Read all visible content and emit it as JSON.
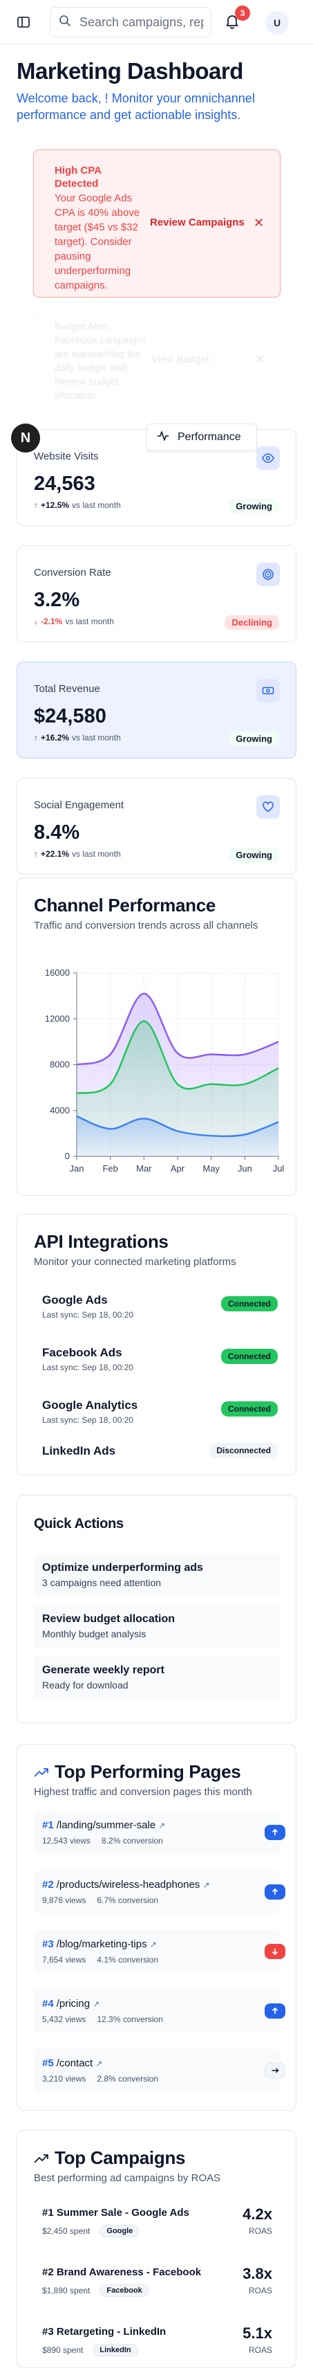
{
  "topbar": {
    "search_placeholder": "Search campaigns, reports...",
    "notification_count": "3",
    "avatar_initial": "U"
  },
  "header": {
    "title": "Marketing Dashboard",
    "subtitle": "Welcome back, ! Monitor your omnichannel performance and get actionable insights."
  },
  "alerts": [
    {
      "title": "High CPA Detected",
      "text": "Your Google Ads CPA is 40% above target ($45 vs $32 target). Consider pausing underperforming campaigns.",
      "action": "Review Campaigns",
      "close": "✕"
    },
    {
      "title": "Budget Alert",
      "text": "Facebook campaigns are approaching the daily budget limit. Review budget allocation.",
      "action": "View Budget",
      "close": "✕"
    }
  ],
  "floating": {
    "logo_letter": "N",
    "tooltip_label": "Performance"
  },
  "kpis": [
    {
      "label": "Website Visits",
      "value": "24,563",
      "change": "+12.5%",
      "period": "vs last month",
      "status": "Growing",
      "direction": "up",
      "icon": "eye-icon"
    },
    {
      "label": "Conversion Rate",
      "value": "3.2%",
      "change": "-2.1%",
      "period": "vs last month",
      "status": "Declining",
      "direction": "down",
      "icon": "target-icon"
    },
    {
      "label": "Total Revenue",
      "value": "$24,580",
      "change": "+16.2%",
      "period": "vs last month",
      "status": "Growing",
      "direction": "up",
      "icon": "money-icon"
    },
    {
      "label": "Social Engagement",
      "value": "8.4%",
      "change": "+22.1%",
      "period": "vs last month",
      "status": "Growing",
      "direction": "up",
      "icon": "heart-icon"
    }
  ],
  "channel_performance": {
    "title": "Channel Performance",
    "subtitle": "Traffic and conversion trends across all channels"
  },
  "chart_data": {
    "type": "area",
    "categories": [
      "Jan",
      "Feb",
      "Mar",
      "Apr",
      "May",
      "Jun",
      "Jul"
    ],
    "ylim": [
      0,
      16000
    ],
    "yticks": [
      0,
      4000,
      8000,
      12000,
      16000
    ],
    "grid": true,
    "series": [
      {
        "color": "#8b5cf6",
        "values": [
          8000,
          8900,
          14200,
          9000,
          8900,
          8900,
          10000
        ]
      },
      {
        "color": "#22c55e",
        "values": [
          5500,
          6300,
          11800,
          6300,
          6300,
          6300,
          7700
        ]
      },
      {
        "color": "#3b82f6",
        "values": [
          3500,
          2400,
          3300,
          2200,
          1800,
          1900,
          3000
        ]
      }
    ],
    "title": "",
    "xlabel": "",
    "ylabel": ""
  },
  "api_integrations": {
    "title": "API Integrations",
    "subtitle": "Monitor your connected marketing platforms",
    "items": [
      {
        "name": "Google Ads",
        "sync": "Last sync: Sep 18, 00:20",
        "status": "Connected"
      },
      {
        "name": "Facebook Ads",
        "sync": "Last sync: Sep 18, 00:20",
        "status": "Connected"
      },
      {
        "name": "Google Analytics",
        "sync": "Last sync: Sep 18, 00:20",
        "status": "Connected"
      },
      {
        "name": "LinkedIn Ads",
        "sync": "",
        "status": "Disconnected"
      }
    ]
  },
  "quick_actions": {
    "title": "Quick Actions",
    "items": [
      {
        "title": "Optimize underperforming ads",
        "subtitle": "3 campaigns need attention"
      },
      {
        "title": "Review budget allocation",
        "subtitle": "Monthly budget analysis"
      },
      {
        "title": "Generate weekly report",
        "subtitle": "Ready for download"
      }
    ]
  },
  "top_pages": {
    "title": "Top Performing Pages",
    "subtitle": "Highest traffic and conversion pages this month",
    "items": [
      {
        "rank": "#1",
        "path": "/landing/summer-sale",
        "views": "12,543 views",
        "conversion": "8.2% conversion",
        "trend": "up"
      },
      {
        "rank": "#2",
        "path": "/products/wireless-headphones",
        "views": "9,876 views",
        "conversion": "6.7% conversion",
        "trend": "up"
      },
      {
        "rank": "#3",
        "path": "/blog/marketing-tips",
        "views": "7,654 views",
        "conversion": "4.1% conversion",
        "trend": "down"
      },
      {
        "rank": "#4",
        "path": "/pricing",
        "views": "5,432 views",
        "conversion": "12.3% conversion",
        "trend": "up"
      },
      {
        "rank": "#5",
        "path": "/contact",
        "views": "3,210 views",
        "conversion": "2.8% conversion",
        "trend": "flat"
      }
    ]
  },
  "top_campaigns": {
    "title": "Top Campaigns",
    "subtitle": "Best performing ad campaigns by ROAS",
    "items": [
      {
        "rank": "#1",
        "name": "Summer Sale - Google Ads",
        "spent": "$2,450 spent",
        "platform": "Google",
        "roas": "4.2x",
        "roas_label": "ROAS"
      },
      {
        "rank": "#2",
        "name": "Brand Awareness - Facebook",
        "spent": "$1,890 spent",
        "platform": "Facebook",
        "roas": "3.8x",
        "roas_label": "ROAS"
      },
      {
        "rank": "#3",
        "name": "Retargeting - LinkedIn",
        "spent": "$890 spent",
        "platform": "LinkedIn",
        "roas": "5.1x",
        "roas_label": "ROAS"
      }
    ]
  }
}
